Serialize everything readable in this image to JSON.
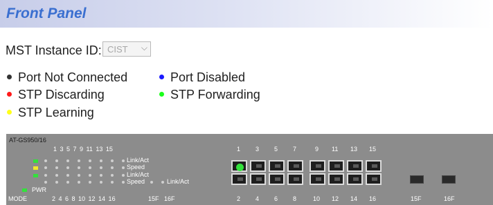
{
  "title": "Front Panel",
  "mst": {
    "label": "MST Instance ID:",
    "value": "CIST"
  },
  "legend": [
    {
      "label": "Port Not Connected",
      "color": "#333333"
    },
    {
      "label": "Port Disabled",
      "color": "#1a1aff"
    },
    {
      "label": "STP Discarding",
      "color": "#ff1a1a"
    },
    {
      "label": "STP Forwarding",
      "color": "#1aff1a"
    },
    {
      "label": "STP Learning",
      "color": "#ffff1a"
    }
  ],
  "panel": {
    "model": "AT-GS950/16",
    "top_port_numbers": "1 3 5 7 9 11 13 15",
    "bottom_port_numbers": "2 4 6 8 10 12 14 16",
    "led_labels": [
      "Link/Act",
      "Speed",
      "Link/Act",
      "Speed",
      "Link/Act"
    ],
    "pwr": "PWR",
    "mode": "MODE",
    "sfp_labels": [
      "15F",
      "16F"
    ],
    "port_top_labels": [
      "1",
      "3",
      "5",
      "7",
      "9",
      "11",
      "13",
      "15"
    ],
    "port_bottom_labels": [
      "2",
      "4",
      "6",
      "8",
      "10",
      "12",
      "14",
      "16"
    ],
    "sfp_port_labels": [
      "15F",
      "16F"
    ]
  },
  "colors": {
    "title": "#3a6fd0",
    "panel_bg": "#8c8c8c",
    "led_green": "#33e13c",
    "led_yellow": "#f2ea2a"
  },
  "icons": [
    "chevron-down-icon",
    "status-dot-icon"
  ]
}
